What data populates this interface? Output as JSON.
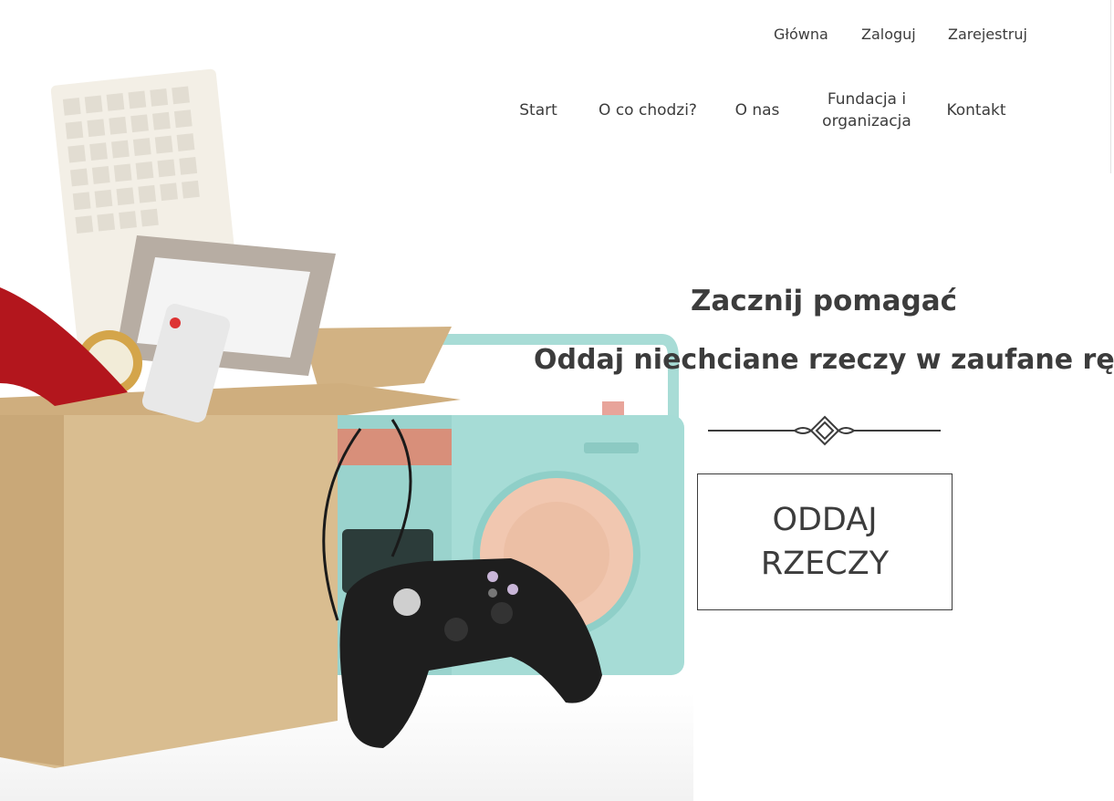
{
  "top_nav": {
    "home": "Główna",
    "login": "Zaloguj",
    "register": "Zarejestruj"
  },
  "main_nav": {
    "start": "Start",
    "about_what": "O co chodzi?",
    "about_us": "O nas",
    "foundations": "Fundacja i organizacja",
    "contact": "Kontakt"
  },
  "hero": {
    "title": "Zacznij pomagać",
    "subtitle": "Oddaj niechciane rzeczy w zaufane ręce",
    "cta_label": "ODDAJ\nRZECZY"
  },
  "colors": {
    "text": "#3c3c3c",
    "box": "#d8b98a",
    "radio": "#9fdad4",
    "controller": "#1e1e1e"
  }
}
